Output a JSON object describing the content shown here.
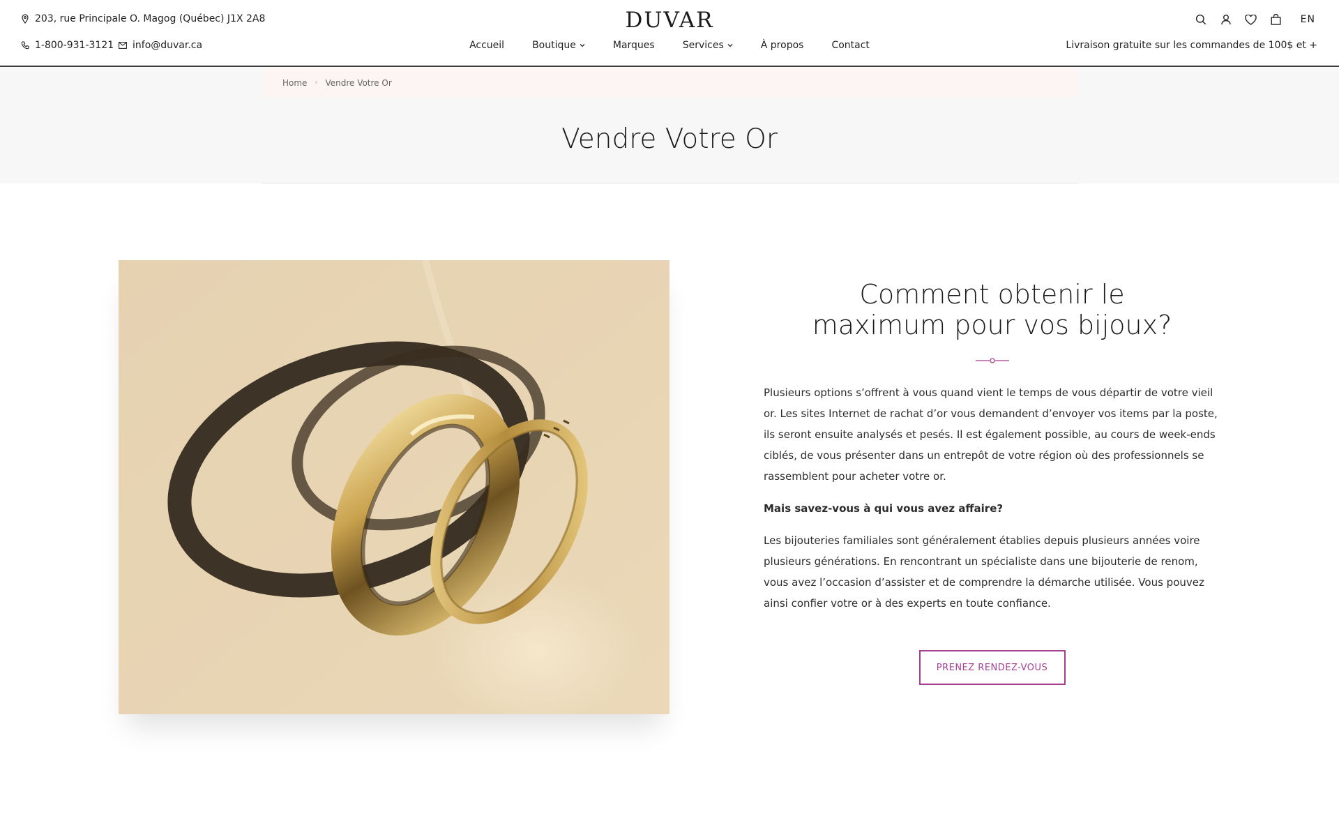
{
  "topbar": {
    "address": "203, rue Principale O. Magog (Québec) J1X 2A8",
    "phone": "1-800-931-3121",
    "email": "info@duvar.ca",
    "logo": "DUVAR",
    "language": "EN",
    "shipping_notice": "Livraison gratuite sur les commandes de 100$ et +"
  },
  "nav": {
    "items": [
      {
        "label": "Accueil",
        "dropdown": false
      },
      {
        "label": "Boutique",
        "dropdown": true
      },
      {
        "label": "Marques",
        "dropdown": false
      },
      {
        "label": "Services",
        "dropdown": true
      },
      {
        "label": "À propos",
        "dropdown": false
      },
      {
        "label": "Contact",
        "dropdown": false
      }
    ]
  },
  "icons": [
    "search-icon",
    "account-icon",
    "wishlist-heart-icon",
    "shopping-bag-icon"
  ],
  "breadcrumb": {
    "home": "Home",
    "current": "Vendre Votre Or"
  },
  "page": {
    "title": "Vendre Votre Or"
  },
  "content": {
    "heading_line1": "Comment obtenir le",
    "heading_line2": "maximum pour vos bijoux?",
    "paragraph1": "Plusieurs options s’offrent à vous quand vient le temps de vous départir de votre vieil or. Les sites Internet de rachat d’or vous demandent d’envoyer vos items par la poste, ils seront ensuite analysés et pesés. Il est également possible, au cours de week-ends ciblés, de vous présenter dans un entrepôt de votre région où des professionnels se rassemblent pour acheter votre or.",
    "question": "Mais savez-vous à qui vous avez affaire?",
    "paragraph2": "Les bijouteries familiales sont généralement établies depuis plusieurs années voire plusieurs générations. En rencontrant un spécialiste dans une bijouterie de renom, vous avez l’occasion d’assister et de comprendre la démarche utilisée. Vous pouvez ainsi confier votre or à des experts en toute confiance.",
    "cta": "PRENEZ RENDEZ-VOUS"
  },
  "colors": {
    "accent": "#a53e91",
    "breadcrumb_bg": "#fdf4f4",
    "title_band_bg": "#f7f7f7",
    "photo_bg": "#e8d3b0"
  }
}
